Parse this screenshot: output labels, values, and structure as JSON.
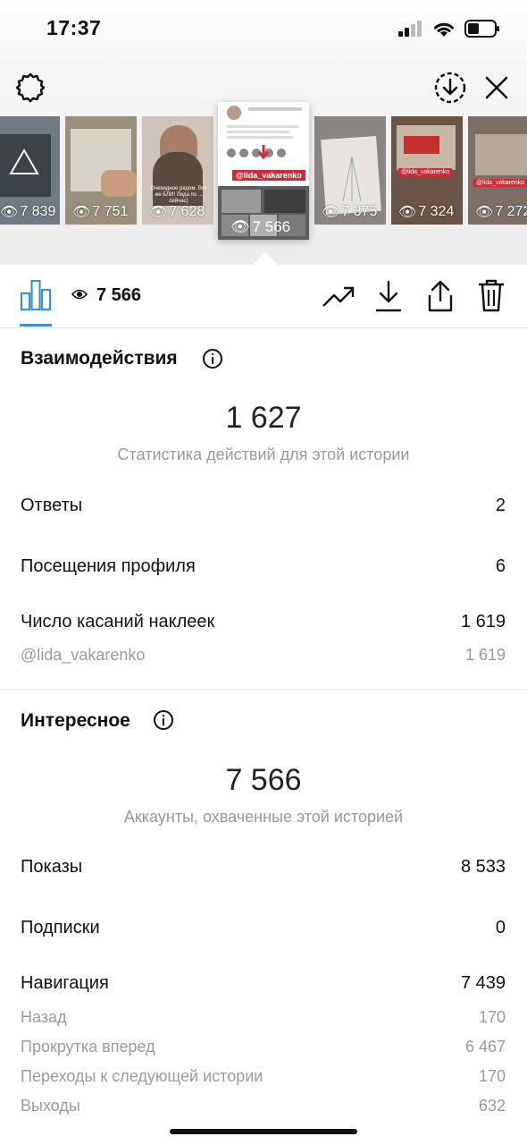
{
  "status_bar": {
    "time": "17:37"
  },
  "stories": [
    {
      "views": "7 839"
    },
    {
      "views": "7 751"
    },
    {
      "views": "7 628",
      "caption": "Очевидное рядом. Вот же БЛИ! Лида по ... сейчас)"
    },
    {
      "views": "7 566",
      "sticker": "@lida_vakarenko",
      "active": true
    },
    {
      "views": "7 375"
    },
    {
      "views": "7 324",
      "sticker": "@lida_vakarenko"
    },
    {
      "views": "7 272",
      "sticker": "@lida_vakarenko"
    }
  ],
  "selected_story": {
    "views": "7 566"
  },
  "interactions": {
    "title": "Взаимодействия",
    "total": "1 627",
    "subtitle": "Статистика действий для этой истории",
    "rows": [
      {
        "label": "Ответы",
        "value": "2"
      },
      {
        "label": "Посещения профиля",
        "value": "6"
      },
      {
        "label": "Число касаний наклеек",
        "value": "1 619"
      }
    ],
    "sticker_detail": {
      "label": "@lida_vakarenko",
      "value": "1 619"
    }
  },
  "discovery": {
    "title": "Интересное",
    "total": "7 566",
    "subtitle": "Аккаунты, охваченные этой историей",
    "rows": [
      {
        "label": "Показы",
        "value": "8 533"
      },
      {
        "label": "Подписки",
        "value": "0"
      },
      {
        "label": "Навигация",
        "value": "7 439"
      }
    ],
    "navigation_detail": [
      {
        "label": "Назад",
        "value": "170"
      },
      {
        "label": "Прокрутка вперед",
        "value": "6 467"
      },
      {
        "label": "Переходы к следующей истории",
        "value": "170"
      },
      {
        "label": "Выходы",
        "value": "632"
      }
    ]
  },
  "colors": {
    "accent": "#3d8fd4",
    "muted": "#9b9b9b",
    "sticker_bg": "#d12b3a"
  }
}
